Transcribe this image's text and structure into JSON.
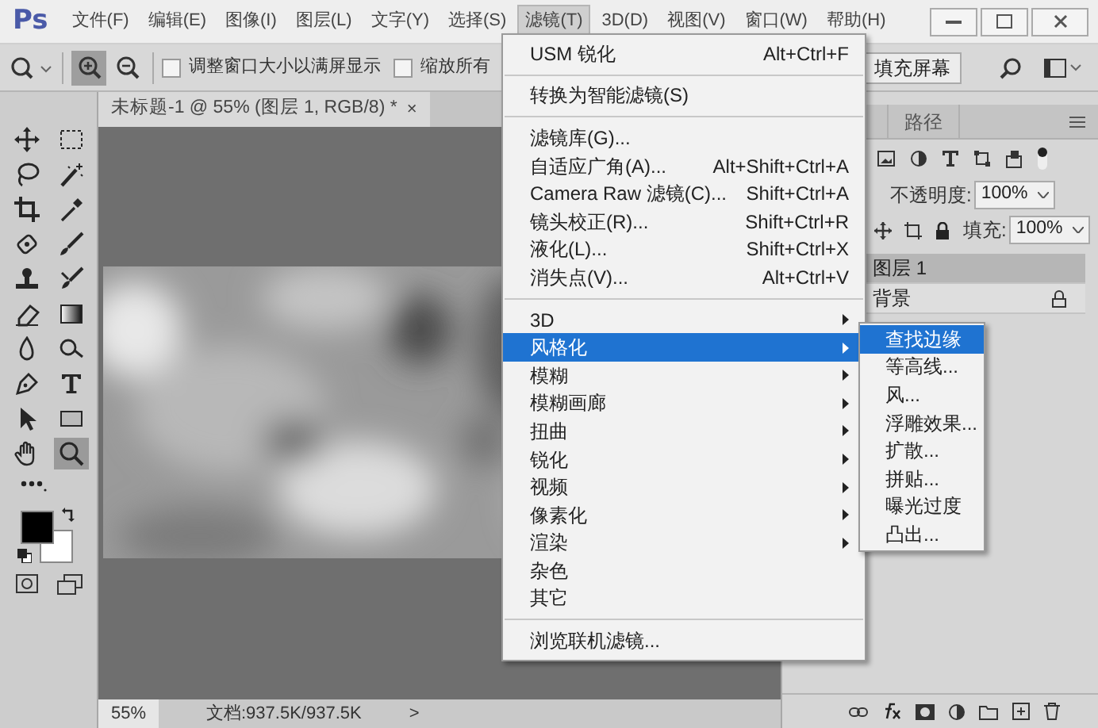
{
  "app": {
    "logo": "Ps"
  },
  "menu_bar": [
    {
      "label": "文件(F)",
      "selected": false
    },
    {
      "label": "编辑(E)",
      "selected": false
    },
    {
      "label": "图像(I)",
      "selected": false
    },
    {
      "label": "图层(L)",
      "selected": false
    },
    {
      "label": "文字(Y)",
      "selected": false
    },
    {
      "label": "选择(S)",
      "selected": false
    },
    {
      "label": "滤镜(T)",
      "selected": true
    },
    {
      "label": "3D(D)",
      "selected": false
    },
    {
      "label": "视图(V)",
      "selected": false
    },
    {
      "label": "窗口(W)",
      "selected": false
    },
    {
      "label": "帮助(H)",
      "selected": false
    }
  ],
  "options_bar": {
    "zoom_buttons": [
      {
        "kind": "zoom-in",
        "selected": true
      },
      {
        "kind": "zoom-out",
        "selected": false
      }
    ],
    "checkboxes": [
      {
        "label": "调整窗口大小以满屏显示",
        "checked": false
      },
      {
        "label": "缩放所有",
        "checked": false
      }
    ],
    "button": "填充屏幕"
  },
  "document": {
    "tab": "未标题-1 @ 55% (图层 1, RGB/8) *",
    "close": "×"
  },
  "tools": [
    {
      "kind": "move",
      "selected": false
    },
    {
      "kind": "marquee",
      "selected": false
    },
    {
      "kind": "lasso",
      "selected": false
    },
    {
      "kind": "wand",
      "selected": false
    },
    {
      "kind": "crop",
      "selected": false
    },
    {
      "kind": "eyedropper",
      "selected": false
    },
    {
      "kind": "bandage",
      "selected": false
    },
    {
      "kind": "brush",
      "selected": false
    },
    {
      "kind": "stamp",
      "selected": false
    },
    {
      "kind": "history",
      "selected": false
    },
    {
      "kind": "eraser",
      "selected": false
    },
    {
      "kind": "gradient",
      "selected": false
    },
    {
      "kind": "drop",
      "selected": false
    },
    {
      "kind": "dodge",
      "selected": false
    },
    {
      "kind": "pen",
      "selected": false
    },
    {
      "kind": "type",
      "selected": false
    },
    {
      "kind": "arrow",
      "selected": false
    },
    {
      "kind": "rect",
      "selected": false
    },
    {
      "kind": "hand",
      "selected": false
    },
    {
      "kind": "zoom",
      "selected": true
    }
  ],
  "status_bar": {
    "zoom": "55%",
    "doc": "文档:937.5K/937.5K",
    "arrow": ">"
  },
  "panel": {
    "tab": "路径",
    "opacity_label": "不透明度:",
    "opacity": "100%",
    "fill_label": "填充:",
    "fill": "100%",
    "layers": [
      {
        "name": "图层 1",
        "selected": true,
        "locked": false
      },
      {
        "name": "背景",
        "selected": false,
        "locked": true
      }
    ]
  },
  "filter_menu": {
    "sections": [
      [
        {
          "label": "USM 锐化",
          "shortcut": "Alt+Ctrl+F",
          "submenu": false,
          "selected": false
        }
      ],
      [
        {
          "label": "转换为智能滤镜(S)",
          "submenu": false,
          "selected": false
        }
      ],
      [
        {
          "label": "滤镜库(G)...",
          "submenu": false,
          "selected": false
        },
        {
          "label": "自适应广角(A)...",
          "shortcut": "Alt+Shift+Ctrl+A",
          "submenu": false,
          "selected": false
        },
        {
          "label": "Camera Raw 滤镜(C)...",
          "shortcut": "Shift+Ctrl+A",
          "submenu": false,
          "selected": false
        },
        {
          "label": "镜头校正(R)...",
          "shortcut": "Shift+Ctrl+R",
          "submenu": false,
          "selected": false
        },
        {
          "label": "液化(L)...",
          "shortcut": "Shift+Ctrl+X",
          "submenu": false,
          "selected": false
        },
        {
          "label": "消失点(V)...",
          "shortcut": "Alt+Ctrl+V",
          "submenu": false,
          "selected": false
        }
      ],
      [
        {
          "label": "3D",
          "submenu": true,
          "selected": false
        },
        {
          "label": "风格化",
          "submenu": true,
          "selected": true
        },
        {
          "label": "模糊",
          "submenu": true,
          "selected": false
        },
        {
          "label": "模糊画廊",
          "submenu": true,
          "selected": false
        },
        {
          "label": "扭曲",
          "submenu": true,
          "selected": false
        },
        {
          "label": "锐化",
          "submenu": true,
          "selected": false
        },
        {
          "label": "视频",
          "submenu": true,
          "selected": false
        },
        {
          "label": "像素化",
          "submenu": true,
          "selected": false
        },
        {
          "label": "渲染",
          "submenu": true,
          "selected": false
        },
        {
          "label": "杂色",
          "submenu": false,
          "selected": false
        },
        {
          "label": "其它",
          "submenu": false,
          "selected": false
        }
      ],
      [
        {
          "label": "浏览联机滤镜...",
          "submenu": false,
          "selected": false
        }
      ]
    ]
  },
  "submenu": {
    "items": [
      {
        "label": "查找边缘",
        "selected": true
      },
      {
        "label": "等高线...",
        "selected": false
      },
      {
        "label": "风...",
        "selected": false
      },
      {
        "label": "浮雕效果...",
        "selected": false
      },
      {
        "label": "扩散...",
        "selected": false
      },
      {
        "label": "拼贴...",
        "selected": false
      },
      {
        "label": "曝光过度",
        "selected": false
      },
      {
        "label": "凸出...",
        "selected": false
      }
    ]
  }
}
